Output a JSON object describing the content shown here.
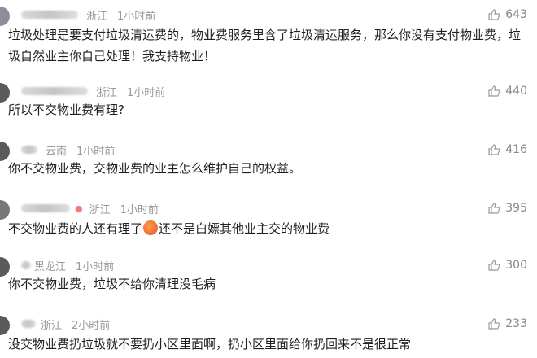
{
  "comments": [
    {
      "location": "浙江",
      "time": "1小时前",
      "text": "垃圾处理是要支付垃圾清运费的，物业费服务里含了垃圾清运服务，那么你没有支付物业费，垃圾自然业主你自己处理！我支持物业！",
      "likes": "643"
    },
    {
      "location": "浙江",
      "time": "1小时前",
      "text": "所以不交物业费有理?",
      "likes": "440"
    },
    {
      "location": "云南",
      "time": "1小时前",
      "text": "你不交物业费，交物业费的业主怎么维护自己的权益。",
      "likes": "416"
    },
    {
      "location": "浙江",
      "time": "1小时前",
      "text_before": "不交物业费的人还有理了",
      "text_after": "还不是白嫖其他业主交的物业费",
      "likes": "395",
      "emoji": "angry-face"
    },
    {
      "location": "黑龙江",
      "time": "1小时前",
      "text": "你不交物业费，垃圾不给你清理没毛病",
      "likes": "300"
    },
    {
      "location": "浙江",
      "time": "2小时前",
      "text": "没交物业费扔垃圾就不要扔小区里面啊，扔小区里面给你扔回来不是很正常",
      "likes": "233"
    }
  ],
  "icons": {
    "like": "thumbs-up-icon",
    "pin": "location-pin-icon"
  },
  "colors": {
    "meta": "#999999",
    "text": "#1f1f1f",
    "pin": "#f27a7a"
  }
}
